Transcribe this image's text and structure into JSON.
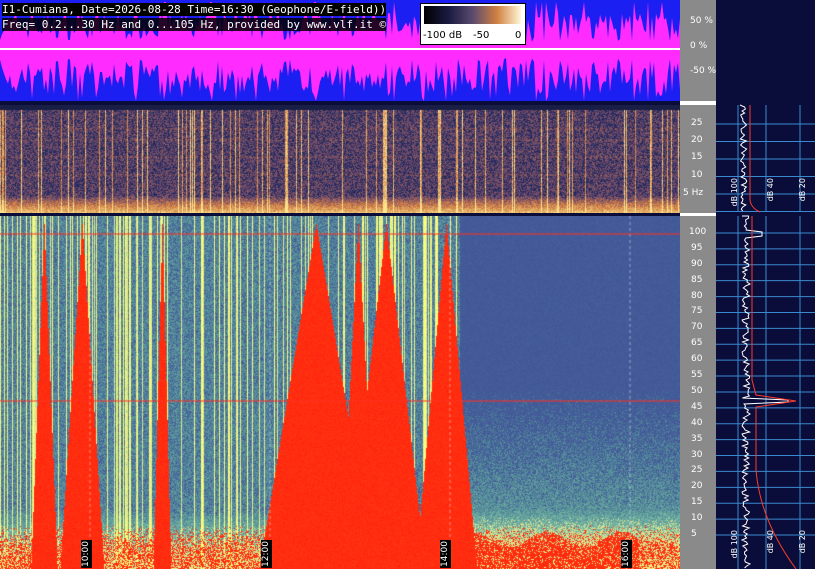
{
  "header": {
    "line1": "I1-Cumiana, Date=2026-08-28 Time=16:30 (Geophone/E-field))",
    "line2": "Freq= 0.2...30 Hz and 0...105 Hz, provided by www.vlf.it ©"
  },
  "colorbar": {
    "labels": [
      "-100 dB",
      "-50",
      "0"
    ]
  },
  "wave_axis": {
    "ticks": [
      "50 %",
      "0 %",
      "-50 %"
    ]
  },
  "spec1_axis": {
    "ticks": [
      "25",
      "20",
      "15",
      "10",
      "5 Hz"
    ]
  },
  "spec2_axis": {
    "ticks": [
      "100",
      "95",
      "90",
      "85",
      "80",
      "75",
      "70",
      "65",
      "60",
      "55",
      "50",
      "45",
      "40",
      "35",
      "30",
      "25",
      "20",
      "15",
      "10",
      "5"
    ]
  },
  "time_marks": [
    "10:00",
    "12:00",
    "14:00",
    "16:00"
  ],
  "profile_labels": {
    "top": [
      "dB 100",
      "dB 40",
      "dB 20"
    ],
    "bottom": [
      "dB 100",
      "dB 40",
      "dB 20"
    ]
  },
  "colors": {
    "waveform_fill": "#ff2bff",
    "waveform_bg": "#1b1ff2",
    "spec_high": "#ff2a10",
    "spec_mid": "#f6f0b0",
    "spec_low": "#3f55a0",
    "profile_line": "#ff3a2a",
    "grid": "#3a8ad0"
  },
  "chart_data": {
    "type": "heatmap",
    "panels": [
      {
        "name": "",
        "yunit": "%",
        "yticks": [
          50,
          0,
          -50
        ]
      },
      {
        "name": "",
        "yunit": "Hz",
        "yticks": [
          25,
          20,
          15,
          10,
          5
        ],
        "ylim": [
          0.2,
          30
        ]
      },
      {
        "name": "",
        "yunit": "Hz",
        "yticks": [
          100,
          95,
          90,
          85,
          80,
          75,
          70,
          65,
          60,
          55,
          50,
          45,
          40,
          35,
          30,
          25,
          20,
          15,
          10,
          5
        ],
        "ylim": [
          0,
          105
        ]
      }
    ],
    "x_time_ticks": [
      "10:00",
      "12:00",
      "14:00",
      "16:00"
    ],
    "colorbar": {
      "min": -100,
      "max": 0,
      "unit": "dB"
    }
  }
}
